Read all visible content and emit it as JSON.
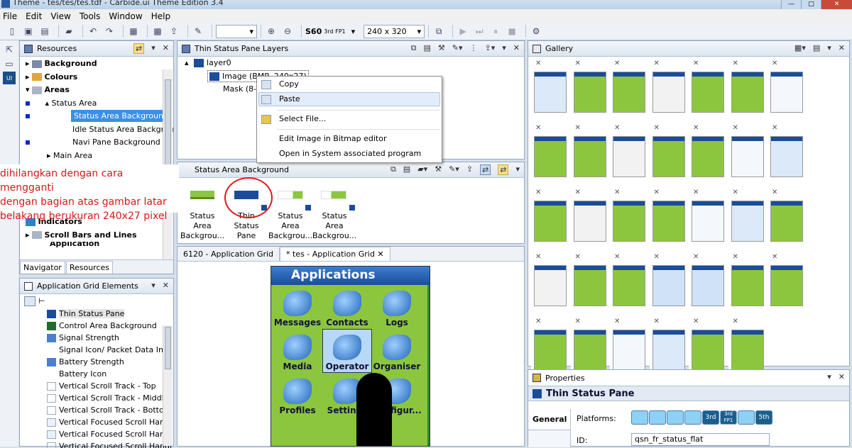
{
  "window": {
    "title": "Theme - tes/tes/tes.tdf - Carbide.ui Theme Edition 3.4",
    "minimize": "—",
    "maximize": "□",
    "close": "✕"
  },
  "menubar": [
    "File",
    "Edit",
    "View",
    "Tools",
    "Window",
    "Help"
  ],
  "toolbar": {
    "platform": "S60",
    "platform_sub": "3rd FP1",
    "resolution": "240 x 320"
  },
  "resources": {
    "title": "Resources",
    "items": [
      {
        "label": "Background",
        "bold": true
      },
      {
        "label": "Colours",
        "bold": true
      },
      {
        "label": "Areas",
        "bold": true
      },
      {
        "label": "Status Area",
        "bold": false
      },
      {
        "label": "Status Area Background",
        "bold": false,
        "selected": true
      },
      {
        "label": "Idle Status Area Backgroun",
        "bold": false
      },
      {
        "label": "Navi Pane Background",
        "bold": false
      },
      {
        "label": "Main Area",
        "bold": false
      }
    ],
    "items_lower": [
      "Indicators",
      "Scroll Bars and Lines",
      "Application"
    ],
    "tabs": [
      "Navigator",
      "Resources"
    ]
  },
  "app_grid_elements": {
    "title": "Application Grid Elements",
    "items": [
      "Thin Status Pane",
      "Control Area Background",
      "Signal Strength",
      "Signal Icon/ Packet Data Indi",
      "Battery Strength",
      "Battery Icon",
      "Vertical Scroll Track - Top",
      "Vertical Scroll Track - Middle",
      "Vertical Scroll Track - Bottom",
      "Vertical Focused Scroll Handl",
      "Vertical Focused Scroll Handl",
      "Vertical Focused Scroll Handl"
    ]
  },
  "layers": {
    "title": "Thin Status Pane Layers",
    "layer": "layer0",
    "image": "Image (BMP, 240x27)",
    "mask": "Mask (8-bit)"
  },
  "context_menu": {
    "copy": "Copy",
    "paste": "Paste",
    "select_file": "Select File...",
    "edit_bitmap": "Edit Image in Bitmap editor",
    "open_system": "Open in System associated program"
  },
  "status_area": {
    "title": "Status Area Background",
    "thumbs": [
      {
        "l1": "Status Area",
        "l2": "Backgrou..."
      },
      {
        "l1": "Thin Status",
        "l2": "Pane"
      },
      {
        "l1": "Status Area",
        "l2": "Backgrou..."
      },
      {
        "l1": "Status Area",
        "l2": "Backgrou..."
      }
    ]
  },
  "annotation": {
    "line1": "dihilangkan dengan cara mengganti",
    "line2": "dengan bagian atas gambar latar",
    "line3": "belakang berukuran 240x27 pixel"
  },
  "editor_tabs": [
    "6120 - Application Grid",
    "* tes - Application Grid"
  ],
  "phone": {
    "header": "Applications",
    "apps": [
      "Messages",
      "Contacts",
      "Logs",
      "Media",
      "Operator",
      "Organiser",
      "Profiles",
      "Settings",
      "Configur..."
    ]
  },
  "gallery": {
    "title": "Gallery"
  },
  "properties": {
    "title": "Properties",
    "heading": "Thin Status Pane",
    "tab": "General",
    "platforms_label": "Platforms:",
    "id_label": "ID:",
    "id_value": "qsn_fr_status_flat",
    "btn_3rd": "3rd",
    "btn_3rdfp1": "3rd FP1",
    "btn_5th": "5th"
  },
  "colors": {
    "accent": "#3b8fe6",
    "theme_green": "#8cc63f",
    "annotation_red": "#d81818"
  }
}
